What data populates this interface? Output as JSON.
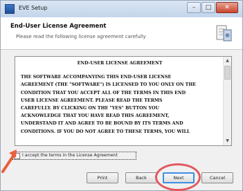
{
  "window": {
    "title": "EVE Setup",
    "controls": {
      "minimize": "–",
      "maximize": "□",
      "close": "✕"
    }
  },
  "header": {
    "title": "End-User License Agreement",
    "subtitle": "Please read the following license agreement carefully"
  },
  "license": {
    "heading": "END-USER LICENSE AGREEMENT",
    "lines": [
      "THE SOFTWARE ACCOMPANYING THIS END-USER LICENSE",
      "AGREEMENT (THE \"SOFTWARE\") IS LICENSED TO YOU ONLY ON THE",
      "CONDITION THAT YOU ACCEPT ALL OF THE TERMS IN THIS END",
      "USER LICENSE AGREEMENT.  PLEASE READ THE TERMS",
      "CAREFULLY.  BY CLICKING ON THE \"YES\" BUTTON YOU",
      "ACKNOWLEDGE THAT YOU HAVE READ THIS AGREEMENT,",
      "UNDERSTAND IT AND AGREE TO BE BOUND BY ITS TERMS AND",
      "CONDITIONS.  IF YOU DO NOT AGREE TO THESE TERMS, YOU WILL"
    ]
  },
  "accept_checkbox": {
    "label": "I accept the terms in the License Agreement",
    "checked": false
  },
  "buttons": {
    "print": "Print",
    "back": "Back",
    "next": "Next",
    "cancel": "Cancel"
  },
  "colors": {
    "annotation": "#e2585e",
    "arrow": "#e8603c",
    "focus": "#3d8ee6"
  }
}
